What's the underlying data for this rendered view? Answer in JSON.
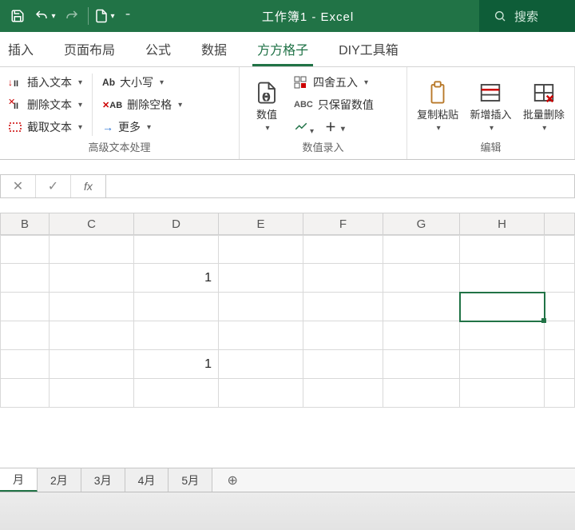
{
  "title": "工作簿1  -  Excel",
  "search_placeholder": "搜索",
  "tabs": {
    "t0": "插入",
    "t1": "页面布局",
    "t2": "公式",
    "t3": "数据",
    "t4": "方方格子",
    "t5": "DIY工具箱"
  },
  "ribbon": {
    "grp_text": {
      "insert_text": "插入文本",
      "delete_text": "删除文本",
      "cut_text": "截取文本",
      "case": "大小写",
      "del_space": "删除空格",
      "more": "更多",
      "label": "高级文本处理"
    },
    "grp_num": {
      "number": "数值",
      "round": "四舍五入",
      "keep_num": "只保留数值",
      "label": "数值录入"
    },
    "grp_edit": {
      "copy_paste": "复制粘贴",
      "insert_new": "新增插入",
      "batch_delete": "批量删除",
      "label": "编辑"
    }
  },
  "fx_label": "fx",
  "columns": {
    "B": "B",
    "C": "C",
    "D": "D",
    "E": "E",
    "F": "F",
    "G": "G",
    "H": "H"
  },
  "cells": {
    "D2": "1",
    "D5": "1"
  },
  "sheets": {
    "s0": "月",
    "s1": "2月",
    "s2": "3月",
    "s3": "4月",
    "s4": "5月"
  }
}
